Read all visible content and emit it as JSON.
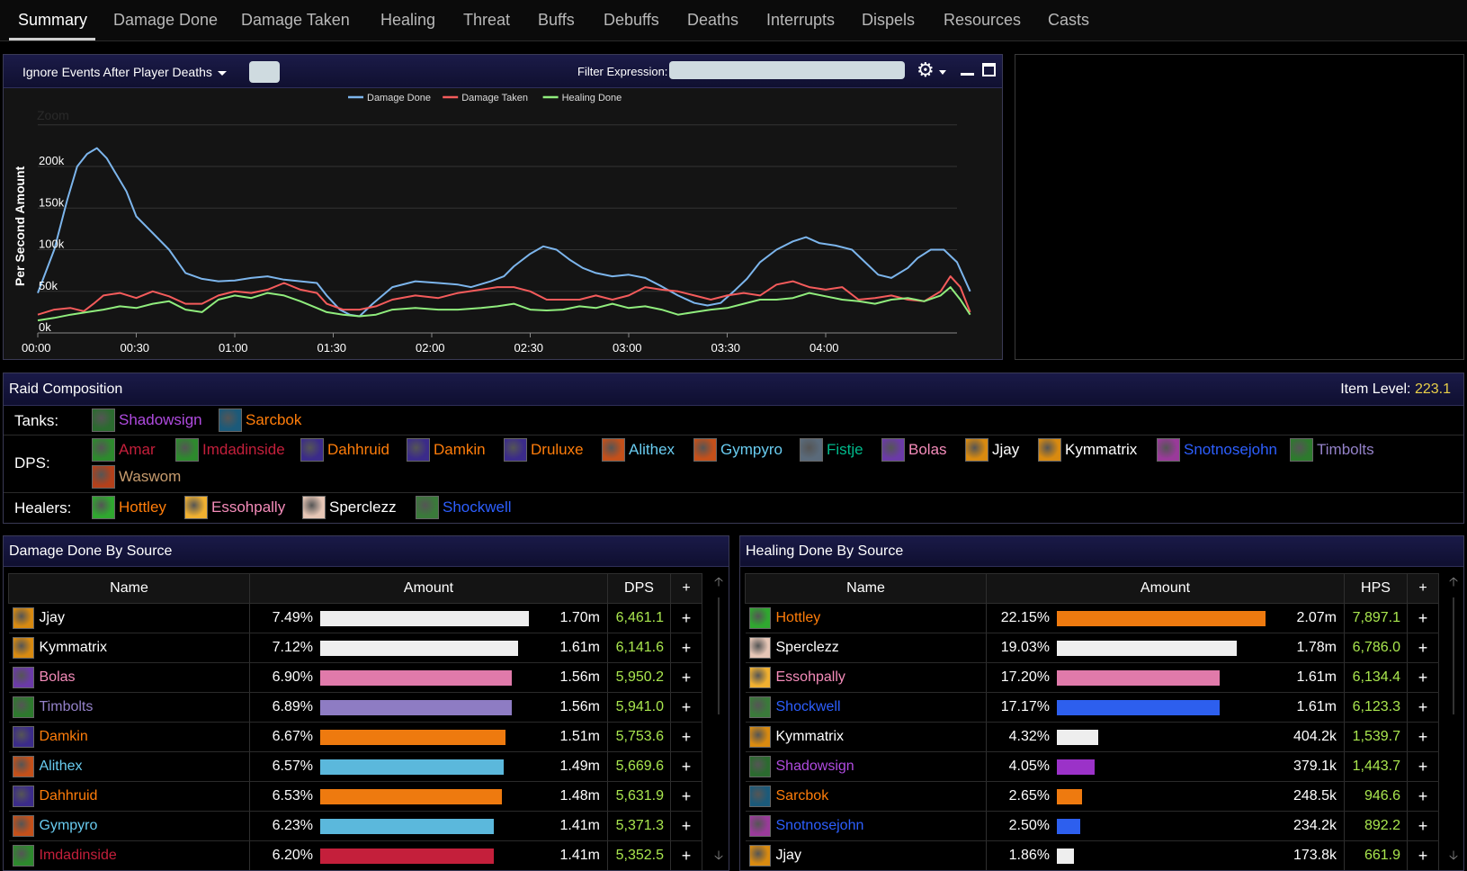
{
  "tabs": [
    "Summary",
    "Damage Done",
    "Damage Taken",
    "Healing",
    "Threat",
    "Buffs",
    "Debuffs",
    "Deaths",
    "Interrupts",
    "Dispels",
    "Resources",
    "Casts"
  ],
  "graph": {
    "dropdown_label": "Ignore Events After Player Deaths",
    "filter_label": "Filter Expression:",
    "filter_value": "",
    "gear_icon": "gear-icon",
    "zoom_label": "Zoom"
  },
  "chart_data": {
    "type": "line",
    "title": "",
    "xlabel": "",
    "ylabel": "Per Second Amount",
    "xlim": [
      0,
      280
    ],
    "ylim": [
      0,
      240000
    ],
    "x_ticks": [
      "00:00",
      "00:30",
      "01:00",
      "01:30",
      "02:00",
      "02:30",
      "03:00",
      "03:30",
      "04:00"
    ],
    "y_ticks": [
      "0k",
      "50k",
      "100k",
      "150k",
      "200k"
    ],
    "legend_position": "top-center",
    "grid": true,
    "series": [
      {
        "name": "Damage Done",
        "color": "#7cb5ec",
        "points": [
          [
            0,
            48000
          ],
          [
            5,
            100000
          ],
          [
            9,
            160000
          ],
          [
            12,
            200000
          ],
          [
            15,
            215000
          ],
          [
            18,
            222000
          ],
          [
            21,
            210000
          ],
          [
            24,
            190000
          ],
          [
            27,
            170000
          ],
          [
            30,
            140000
          ],
          [
            35,
            120000
          ],
          [
            40,
            100000
          ],
          [
            45,
            72000
          ],
          [
            50,
            65000
          ],
          [
            55,
            62000
          ],
          [
            60,
            63000
          ],
          [
            65,
            66000
          ],
          [
            70,
            68000
          ],
          [
            75,
            64000
          ],
          [
            80,
            62000
          ],
          [
            85,
            60000
          ],
          [
            88,
            45000
          ],
          [
            92,
            28000
          ],
          [
            95,
            22000
          ],
          [
            98,
            20000
          ],
          [
            102,
            35000
          ],
          [
            108,
            55000
          ],
          [
            115,
            62000
          ],
          [
            122,
            60000
          ],
          [
            128,
            58000
          ],
          [
            132,
            55000
          ],
          [
            138,
            62000
          ],
          [
            142,
            68000
          ],
          [
            145,
            80000
          ],
          [
            150,
            95000
          ],
          [
            154,
            104000
          ],
          [
            158,
            100000
          ],
          [
            162,
            88000
          ],
          [
            166,
            78000
          ],
          [
            170,
            72000
          ],
          [
            175,
            68000
          ],
          [
            180,
            70000
          ],
          [
            185,
            66000
          ],
          [
            190,
            56000
          ],
          [
            195,
            45000
          ],
          [
            200,
            36000
          ],
          [
            204,
            33000
          ],
          [
            208,
            36000
          ],
          [
            212,
            50000
          ],
          [
            216,
            65000
          ],
          [
            220,
            85000
          ],
          [
            225,
            100000
          ],
          [
            230,
            110000
          ],
          [
            234,
            115000
          ],
          [
            238,
            108000
          ],
          [
            243,
            105000
          ],
          [
            248,
            100000
          ],
          [
            252,
            85000
          ],
          [
            256,
            70000
          ],
          [
            260,
            66000
          ],
          [
            265,
            78000
          ],
          [
            268,
            90000
          ],
          [
            272,
            100000
          ],
          [
            276,
            100000
          ],
          [
            280,
            85000
          ],
          [
            284,
            50000
          ]
        ]
      },
      {
        "name": "Damage Taken",
        "color": "#f45b5b",
        "points": [
          [
            0,
            22000
          ],
          [
            5,
            28000
          ],
          [
            10,
            30000
          ],
          [
            14,
            26000
          ],
          [
            17,
            35000
          ],
          [
            20,
            45000
          ],
          [
            25,
            48000
          ],
          [
            30,
            42000
          ],
          [
            35,
            50000
          ],
          [
            40,
            44000
          ],
          [
            45,
            35000
          ],
          [
            50,
            35000
          ],
          [
            55,
            45000
          ],
          [
            60,
            50000
          ],
          [
            65,
            48000
          ],
          [
            70,
            52000
          ],
          [
            75,
            60000
          ],
          [
            80,
            52000
          ],
          [
            85,
            48000
          ],
          [
            88,
            35000
          ],
          [
            93,
            28000
          ],
          [
            98,
            28000
          ],
          [
            103,
            32000
          ],
          [
            108,
            40000
          ],
          [
            115,
            45000
          ],
          [
            122,
            42000
          ],
          [
            128,
            48000
          ],
          [
            135,
            52000
          ],
          [
            140,
            55000
          ],
          [
            145,
            55000
          ],
          [
            150,
            50000
          ],
          [
            155,
            40000
          ],
          [
            160,
            40000
          ],
          [
            165,
            40000
          ],
          [
            170,
            45000
          ],
          [
            175,
            40000
          ],
          [
            180,
            45000
          ],
          [
            185,
            55000
          ],
          [
            190,
            52000
          ],
          [
            195,
            50000
          ],
          [
            200,
            45000
          ],
          [
            205,
            40000
          ],
          [
            210,
            45000
          ],
          [
            215,
            48000
          ],
          [
            220,
            45000
          ],
          [
            225,
            58000
          ],
          [
            230,
            62000
          ],
          [
            235,
            55000
          ],
          [
            240,
            52000
          ],
          [
            245,
            55000
          ],
          [
            250,
            40000
          ],
          [
            255,
            42000
          ],
          [
            260,
            45000
          ],
          [
            265,
            40000
          ],
          [
            270,
            38000
          ],
          [
            275,
            50000
          ],
          [
            278,
            68000
          ],
          [
            281,
            55000
          ],
          [
            284,
            25000
          ]
        ]
      },
      {
        "name": "Healing Done",
        "color": "#90ed7d",
        "points": [
          [
            0,
            15000
          ],
          [
            5,
            18000
          ],
          [
            10,
            22000
          ],
          [
            15,
            25000
          ],
          [
            20,
            28000
          ],
          [
            25,
            32000
          ],
          [
            30,
            30000
          ],
          [
            35,
            35000
          ],
          [
            40,
            38000
          ],
          [
            45,
            28000
          ],
          [
            50,
            25000
          ],
          [
            55,
            40000
          ],
          [
            60,
            45000
          ],
          [
            65,
            42000
          ],
          [
            70,
            48000
          ],
          [
            75,
            45000
          ],
          [
            80,
            38000
          ],
          [
            85,
            30000
          ],
          [
            88,
            25000
          ],
          [
            93,
            22000
          ],
          [
            98,
            20000
          ],
          [
            103,
            22000
          ],
          [
            108,
            28000
          ],
          [
            115,
            30000
          ],
          [
            122,
            28000
          ],
          [
            128,
            28000
          ],
          [
            135,
            30000
          ],
          [
            140,
            32000
          ],
          [
            145,
            35000
          ],
          [
            150,
            28000
          ],
          [
            155,
            27000
          ],
          [
            160,
            28000
          ],
          [
            165,
            32000
          ],
          [
            170,
            30000
          ],
          [
            175,
            35000
          ],
          [
            180,
            30000
          ],
          [
            185,
            32000
          ],
          [
            190,
            28000
          ],
          [
            195,
            22000
          ],
          [
            200,
            25000
          ],
          [
            205,
            28000
          ],
          [
            210,
            30000
          ],
          [
            215,
            35000
          ],
          [
            220,
            40000
          ],
          [
            225,
            40000
          ],
          [
            230,
            42000
          ],
          [
            235,
            48000
          ],
          [
            240,
            44000
          ],
          [
            245,
            40000
          ],
          [
            250,
            38000
          ],
          [
            255,
            35000
          ],
          [
            260,
            40000
          ],
          [
            265,
            42000
          ],
          [
            270,
            38000
          ],
          [
            275,
            45000
          ],
          [
            278,
            55000
          ],
          [
            281,
            40000
          ],
          [
            284,
            22000
          ]
        ]
      }
    ]
  },
  "raid": {
    "title": "Raid Composition",
    "ilvl_label": "Item Level:",
    "ilvl_value": "223.1",
    "tanks_label": "Tanks:",
    "dps_label": "DPS:",
    "healers_label": "Healers:",
    "tanks": [
      {
        "name": "Shadowsign",
        "color": "#b04be0",
        "icon": "#2b6b2f"
      },
      {
        "name": "Sarcbok",
        "color": "#ff7d0a",
        "icon": "#1b5a7a"
      }
    ],
    "dps": [
      {
        "name": "Amar",
        "color": "#c41f3b",
        "icon": "#2d8a2d"
      },
      {
        "name": "Imdadinside",
        "color": "#c41f3b",
        "icon": "#2d8a2d"
      },
      {
        "name": "Dahhruid",
        "color": "#ff7d0a",
        "icon": "#3b2b8a"
      },
      {
        "name": "Damkin",
        "color": "#ff7d0a",
        "icon": "#3b2b8a"
      },
      {
        "name": "Druluxe",
        "color": "#ff7d0a",
        "icon": "#3b2b8a"
      },
      {
        "name": "Alithex",
        "color": "#69ccf0",
        "icon": "#c4501a"
      },
      {
        "name": "Gympyro",
        "color": "#69ccf0",
        "icon": "#c4501a"
      },
      {
        "name": "Fistje",
        "color": "#00b98b",
        "icon": "#5a6a7a"
      },
      {
        "name": "Bolas",
        "color": "#f58cba",
        "icon": "#6b3aa8"
      },
      {
        "name": "Jjay",
        "color": "#ffffff",
        "icon": "#d88a10"
      },
      {
        "name": "Kymmatrix",
        "color": "#ffffff",
        "icon": "#d88a10"
      },
      {
        "name": "Snotnosejohn",
        "color": "#2d5fff",
        "icon": "#9a3a9a"
      },
      {
        "name": "Timbolts",
        "color": "#9482c9",
        "icon": "#2d7a2d"
      },
      {
        "name": "Waswom",
        "color": "#c79c6e",
        "icon": "#b4401a"
      }
    ],
    "healers": [
      {
        "name": "Hottley",
        "color": "#ff7d0a",
        "icon": "#2fa82f"
      },
      {
        "name": "Essohpally",
        "color": "#f58cba",
        "icon": "#f0b030"
      },
      {
        "name": "Sperclezz",
        "color": "#ffffff",
        "icon": "#e6c6b6"
      },
      {
        "name": "Shockwell",
        "color": "#2d5fff",
        "icon": "#3a7a3a"
      }
    ]
  },
  "damage_table": {
    "title": "Damage Done By Source",
    "headers": {
      "name": "Name",
      "amount": "Amount",
      "rate": "DPS",
      "plus": "+"
    },
    "rows": [
      {
        "name": "Jjay",
        "color": "#ffffff",
        "icon": "#d88a10",
        "pct": "7.49%",
        "frac": 1.0,
        "bar": "#eeeeee",
        "amount": "1.70m",
        "rate": "6,461.1"
      },
      {
        "name": "Kymmatrix",
        "color": "#ffffff",
        "icon": "#d88a10",
        "pct": "7.12%",
        "frac": 0.95,
        "bar": "#eeeeee",
        "amount": "1.61m",
        "rate": "6,141.6"
      },
      {
        "name": "Bolas",
        "color": "#f58cba",
        "icon": "#6b3aa8",
        "pct": "6.90%",
        "frac": 0.92,
        "bar": "#e07aaa",
        "amount": "1.56m",
        "rate": "5,950.2"
      },
      {
        "name": "Timbolts",
        "color": "#9482c9",
        "icon": "#2d7a2d",
        "pct": "6.89%",
        "frac": 0.92,
        "bar": "#8e7cc3",
        "amount": "1.56m",
        "rate": "5,941.0"
      },
      {
        "name": "Damkin",
        "color": "#ff7d0a",
        "icon": "#3b2b8a",
        "pct": "6.67%",
        "frac": 0.89,
        "bar": "#ee7a0f",
        "amount": "1.51m",
        "rate": "5,753.6"
      },
      {
        "name": "Alithex",
        "color": "#69ccf0",
        "icon": "#c4501a",
        "pct": "6.57%",
        "frac": 0.88,
        "bar": "#5bb8dc",
        "amount": "1.49m",
        "rate": "5,669.6"
      },
      {
        "name": "Dahhruid",
        "color": "#ff7d0a",
        "icon": "#3b2b8a",
        "pct": "6.53%",
        "frac": 0.87,
        "bar": "#ee7a0f",
        "amount": "1.48m",
        "rate": "5,631.9"
      },
      {
        "name": "Gympyro",
        "color": "#69ccf0",
        "icon": "#c4501a",
        "pct": "6.23%",
        "frac": 0.83,
        "bar": "#5bb8dc",
        "amount": "1.41m",
        "rate": "5,371.3"
      },
      {
        "name": "Imdadinside",
        "color": "#c41f3b",
        "icon": "#2d8a2d",
        "pct": "6.20%",
        "frac": 0.83,
        "bar": "#c41f3b",
        "amount": "1.41m",
        "rate": "5,352.5"
      }
    ]
  },
  "healing_table": {
    "title": "Healing Done By Source",
    "headers": {
      "name": "Name",
      "amount": "Amount",
      "rate": "HPS",
      "plus": "+"
    },
    "rows": [
      {
        "name": "Hottley",
        "color": "#ff7d0a",
        "icon": "#2fa82f",
        "pct": "22.15%",
        "frac": 1.0,
        "bar": "#ee7a0f",
        "amount": "2.07m",
        "rate": "7,897.1"
      },
      {
        "name": "Sperclezz",
        "color": "#ffffff",
        "icon": "#e6c6b6",
        "pct": "19.03%",
        "frac": 0.86,
        "bar": "#eeeeee",
        "amount": "1.78m",
        "rate": "6,786.0"
      },
      {
        "name": "Essohpally",
        "color": "#f58cba",
        "icon": "#f0b030",
        "pct": "17.20%",
        "frac": 0.78,
        "bar": "#e07aaa",
        "amount": "1.61m",
        "rate": "6,134.4"
      },
      {
        "name": "Shockwell",
        "color": "#2d5fff",
        "icon": "#3a7a3a",
        "pct": "17.17%",
        "frac": 0.78,
        "bar": "#2d5fee",
        "amount": "1.61m",
        "rate": "6,123.3"
      },
      {
        "name": "Kymmatrix",
        "color": "#ffffff",
        "icon": "#d88a10",
        "pct": "4.32%",
        "frac": 0.2,
        "bar": "#eeeeee",
        "amount": "404.2k",
        "rate": "1,539.7"
      },
      {
        "name": "Shadowsign",
        "color": "#b04be0",
        "icon": "#2b6b2f",
        "pct": "4.05%",
        "frac": 0.18,
        "bar": "#9b32c8",
        "amount": "379.1k",
        "rate": "1,443.7"
      },
      {
        "name": "Sarcbok",
        "color": "#ff7d0a",
        "icon": "#1b5a7a",
        "pct": "2.65%",
        "frac": 0.12,
        "bar": "#ee7a0f",
        "amount": "248.5k",
        "rate": "946.6"
      },
      {
        "name": "Snotnosejohn",
        "color": "#2d5fff",
        "icon": "#9a3a9a",
        "pct": "2.50%",
        "frac": 0.11,
        "bar": "#2d5fee",
        "amount": "234.2k",
        "rate": "892.2"
      },
      {
        "name": "Jjay",
        "color": "#ffffff",
        "icon": "#d88a10",
        "pct": "1.86%",
        "frac": 0.08,
        "bar": "#eeeeee",
        "amount": "173.8k",
        "rate": "661.9"
      }
    ]
  }
}
